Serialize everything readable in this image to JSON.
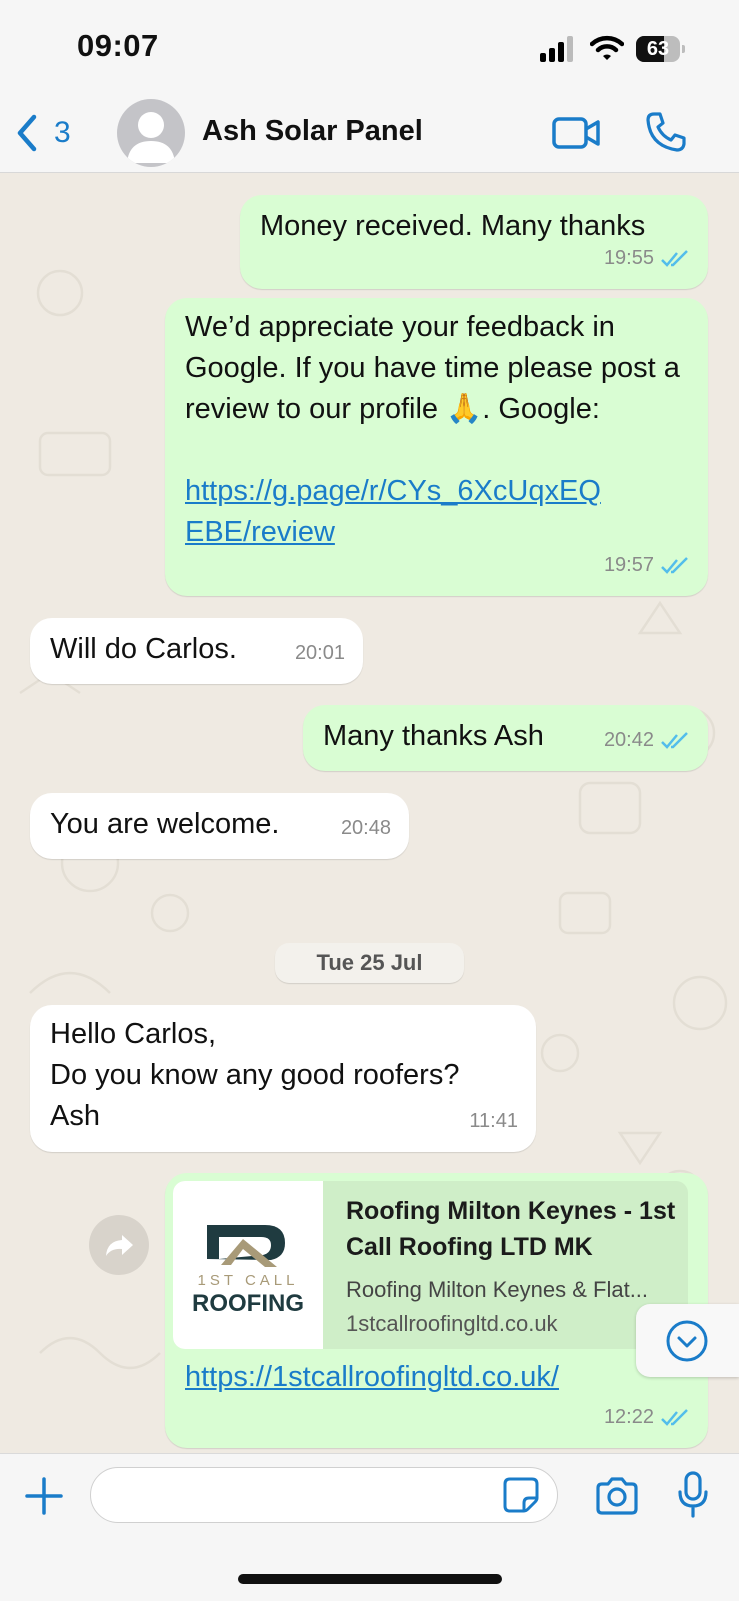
{
  "status_bar": {
    "time": "09:07",
    "battery": "63",
    "battery_level": 0.63
  },
  "header": {
    "back_count": "3",
    "contact_name": "Ash Solar Panel",
    "icons": [
      "chevron-left-icon",
      "avatar",
      "video-icon",
      "phone-icon"
    ]
  },
  "messages": [
    {
      "dir": "out",
      "text": "Money received. Many thanks",
      "time": "19:55",
      "read": true
    },
    {
      "dir": "out",
      "text": "We’d appreciate your feedback in Google. If you have time please post a review to our profile 🙏. Google:",
      "link": "https://g.page/r/CYs_6XcUqxEQEBE/review",
      "time": "19:57",
      "read": true
    },
    {
      "dir": "in",
      "text": "Will do Carlos.",
      "time": "20:01"
    },
    {
      "dir": "out",
      "text": "Many thanks Ash",
      "time": "20:42",
      "read": true
    },
    {
      "dir": "in",
      "text": "You are welcome.",
      "time": "20:48"
    },
    {
      "dir": "in",
      "text": "Hello Carlos,\nDo you know any good roofers?\nAsh",
      "time": "11:41"
    },
    {
      "dir": "out",
      "link": "https://1stcallroofingltd.co.uk/",
      "time": "12:22",
      "read": true,
      "preview": {
        "title": "Roofing Milton Keynes - 1st Call Roofing LTD MK",
        "description": "Roofing Milton Keynes & Flat...",
        "domain": "1stcallroofingltd.co.uk",
        "logo_top": "1ST CALL",
        "logo_bottom": "ROOFING"
      }
    }
  ],
  "date_separator": "Tue 25 Jul",
  "input": {
    "placeholder": "",
    "value": ""
  },
  "colors": {
    "outgoing": "#d9fdd3",
    "incoming": "#ffffff",
    "accent": "#1a7cc9",
    "background": "#efeae2",
    "read_ticks": "#53bdeb"
  }
}
